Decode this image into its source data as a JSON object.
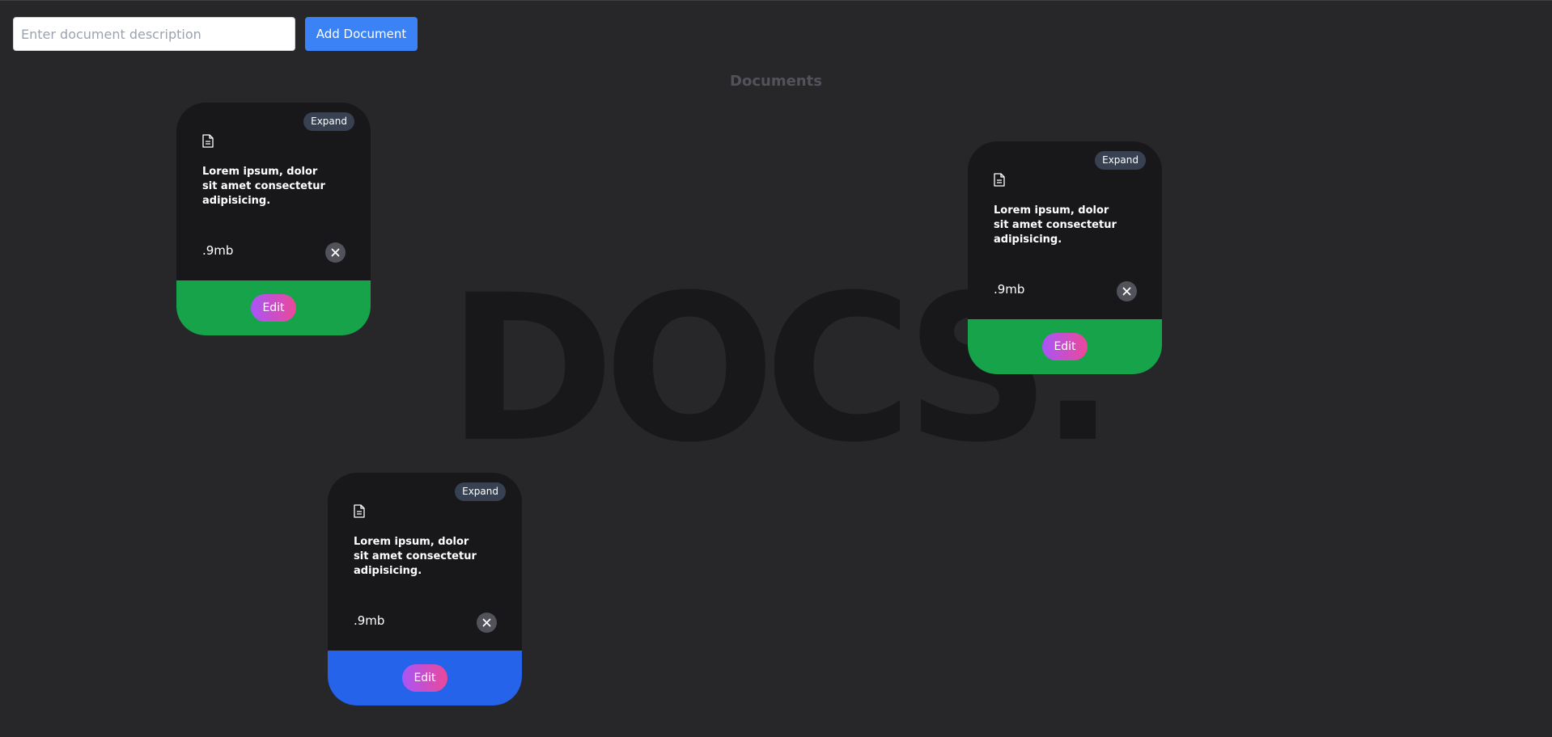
{
  "background_word": "DOCS.",
  "toolbar": {
    "input_placeholder": "Enter document description",
    "input_value": "",
    "add_label": "Add Document"
  },
  "section_title": "Documents",
  "cards": [
    {
      "expand_label": "Expand",
      "icon": "document-icon",
      "title": "Lorem ipsum, dolor sit amet consectetur adipisicing.",
      "size": ".9mb",
      "edit_label": "Edit",
      "footer_color": "#16a34a"
    },
    {
      "expand_label": "Expand",
      "icon": "document-icon",
      "title": "Lorem ipsum, dolor sit amet consectetur adipisicing.",
      "size": ".9mb",
      "edit_label": "Edit",
      "footer_color": "#16a34a"
    },
    {
      "expand_label": "Expand",
      "icon": "document-icon",
      "title": "Lorem ipsum, dolor sit amet consectetur adipisicing.",
      "size": ".9mb",
      "edit_label": "Edit",
      "footer_color": "#2563eb"
    }
  ],
  "colors": {
    "page_bg": "#27272a",
    "card_bg": "#18181b",
    "accent_blue": "#3b82f6",
    "edit_gradient_start": "#a855f7",
    "edit_gradient_end": "#ec4899"
  }
}
